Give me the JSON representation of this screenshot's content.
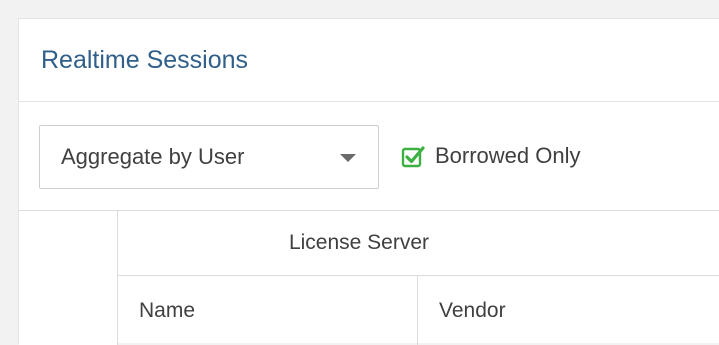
{
  "panel": {
    "title": "Realtime Sessions"
  },
  "toolbar": {
    "aggregate_select": {
      "selected": "Aggregate by User"
    },
    "borrowed_only": {
      "label": "Borrowed Only",
      "checked": true,
      "check_color": "#3cb043"
    }
  },
  "table": {
    "group_header": "License Server",
    "columns": [
      "Name",
      "Vendor"
    ]
  },
  "colors": {
    "title": "#2f5f8a",
    "text": "#404040",
    "border": "#dcdcdc",
    "background": "#f2f2f2"
  }
}
